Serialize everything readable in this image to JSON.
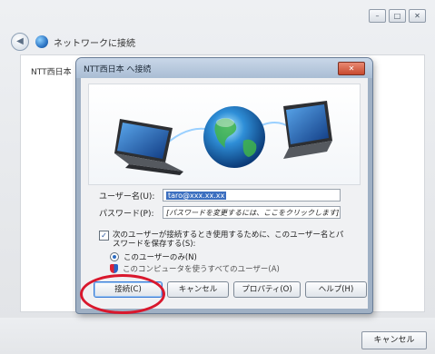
{
  "outer_window": {
    "title": "ネットワークに接続",
    "connection_label": "NTT西日本",
    "cancel_label": "キャンセル",
    "controls": [
      "–",
      "□",
      "✕"
    ]
  },
  "dialog": {
    "title": "NTT西日本 へ接続",
    "close_label": "✕",
    "username_label": "ユーザー名(U):",
    "username_value": "taro@xxx.xx.xx",
    "password_label": "パスワード(P):",
    "password_value": "[パスワードを変更するには、ここをクリックします]",
    "save_credentials_label": "次のユーザーが接続するとき使用するために、このユーザー名とパスワードを保存する(S):",
    "radio_me_only_label": "このユーザーのみ(N)",
    "radio_all_users_label": "このコンピュータを使うすべてのユーザー(A)",
    "buttons": {
      "connect": "接続(C)",
      "cancel": "キャンセル",
      "properties": "プロパティ(O)",
      "help": "ヘルプ(H)"
    }
  },
  "icons": {
    "back": "back-arrow-icon",
    "network": "network-globe-icon",
    "banner": "laptop-globe-laptop-illustration",
    "shield": "uac-shield-icon"
  },
  "colors": {
    "highlight_ring": "#d9182d",
    "selection": "#3c6fc0"
  }
}
